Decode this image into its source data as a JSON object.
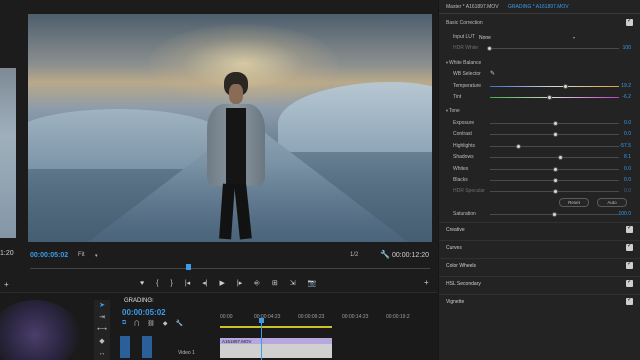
{
  "program_monitor": {
    "left_panel_time": "1:20",
    "current_time": "00:00:05:02",
    "zoom": "Fit",
    "resolution": "1/2",
    "duration": "00:00:12:20",
    "playhead_fraction": 0.39,
    "transport": [
      "♥",
      "{",
      "}",
      "|◂",
      "◂|",
      "▶",
      "|▸",
      "⎆",
      "⊞",
      "⇲",
      "📷"
    ]
  },
  "timeline": {
    "sequence_name": "GRADING",
    "close_glyph": "≡",
    "timecode": "00:00:05:02",
    "ruler": [
      "00:00",
      "00:00:04:23",
      "00:00:09:23",
      "00:00:14:23",
      "00:00:19:2"
    ],
    "track_label": "Video 1",
    "clip_name": "A161897.MOV",
    "playhead_fraction": 0.36
  },
  "lumetri": {
    "master_label": "Master * A161897.MOV",
    "clip_label": "GRADING * A161897.MOV",
    "basic_correction": "Basic Correction",
    "input_lut_label": "Input LUT",
    "input_lut_value": "None",
    "hdr_white_label": "HDR White",
    "hdr_white_value": "100",
    "white_balance": "White Balance",
    "wb_selector": "WB Selector",
    "temperature_label": "Temperature",
    "temperature_value": "19.2",
    "tint_label": "Tint",
    "tint_value": "-6.2",
    "tone": "Tone",
    "sliders": [
      {
        "label": "Exposure",
        "value": "0.0",
        "pos": 0.5
      },
      {
        "label": "Contrast",
        "value": "0.0",
        "pos": 0.5
      },
      {
        "label": "Highlights",
        "value": "-57.5",
        "pos": 0.22
      },
      {
        "label": "Shadows",
        "value": "8.1",
        "pos": 0.54
      },
      {
        "label": "Whites",
        "value": "0.0",
        "pos": 0.5
      },
      {
        "label": "Blacks",
        "value": "0.0",
        "pos": 0.5
      },
      {
        "label": "HDR Specular",
        "value": "0.0",
        "pos": 0.5
      }
    ],
    "reset_label": "Reset",
    "auto_label": "Auto",
    "saturation_label": "Saturation",
    "saturation_value": "100.0",
    "sections": [
      "Creative",
      "Curves",
      "Color Wheels",
      "HSL Secondary",
      "Vignette"
    ]
  },
  "colors": {
    "accent": "#3d9be9",
    "panel_bg": "#232323"
  }
}
